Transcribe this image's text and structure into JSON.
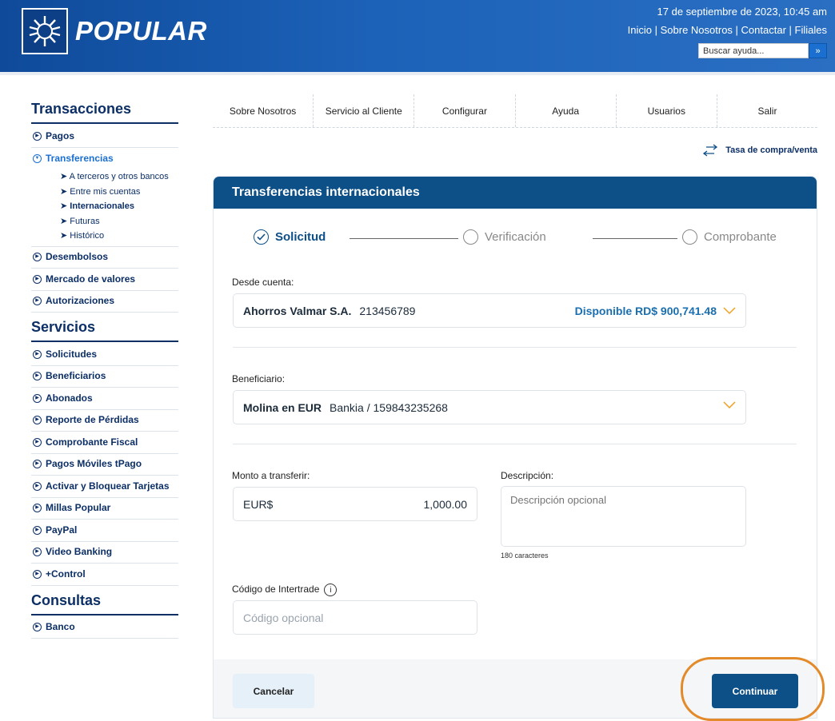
{
  "header": {
    "brand": "POPULAR",
    "datetime": "17 de septiembre de 2023, 10:45 am",
    "links": [
      "Inicio",
      "Sobre Nosotros",
      "Contactar",
      "Filiales"
    ],
    "separator": " | ",
    "search_placeholder": "Buscar ayuda...",
    "search_button": "»"
  },
  "sidebar": {
    "transacciones": {
      "heading": "Transacciones",
      "items": {
        "pagos": "Pagos",
        "transferencias": "Transferencias",
        "sub": [
          "A terceros y otros bancos",
          "Entre mis cuentas",
          "Internacionales",
          "Futuras",
          "Histórico"
        ],
        "desembolsos": "Desembolsos",
        "mercado": "Mercado de valores",
        "autorizaciones": "Autorizaciones"
      }
    },
    "servicios": {
      "heading": "Servicios",
      "items": [
        "Solicitudes",
        "Beneficiarios",
        "Abonados",
        "Reporte de Pérdidas",
        "Comprobante Fiscal",
        "Pagos Móviles tPago",
        "Activar y Bloquear Tarjetas",
        "Millas Popular",
        "PayPal",
        "Video Banking",
        "+Control"
      ]
    },
    "consultas": {
      "heading": "Consultas",
      "items": [
        "Banco"
      ]
    }
  },
  "topnav": [
    "Sobre Nosotros",
    "Servicio al Cliente",
    "Configurar",
    "Ayuda",
    "Usuarios",
    "Salir"
  ],
  "rate_link": "Tasa de compra/venta",
  "card": {
    "title": "Transferencias internacionales",
    "steps": [
      "Solicitud",
      "Verificación",
      "Comprobante"
    ],
    "from": {
      "label": "Desde cuenta:",
      "account_name": "Ahorros Valmar S.A.",
      "account_number": "213456789",
      "available": "Disponible RD$ 900,741.48"
    },
    "beneficiary": {
      "label": "Beneficiario:",
      "name": "Molina en EUR",
      "detail": "Bankia / 159843235268"
    },
    "amount": {
      "label": "Monto a transferir:",
      "currency": "EUR$",
      "value": "1,000.00"
    },
    "description": {
      "label": "Descripción:",
      "placeholder": "Descripción opcional",
      "note": "180 caracteres"
    },
    "intertrade": {
      "label": "Código de Intertrade",
      "placeholder": "Código opcional"
    },
    "buttons": {
      "cancel": "Cancelar",
      "continue": "Continuar"
    }
  },
  "colors": {
    "brand_blue": "#0d4f87",
    "accent_blue": "#1a6fb0",
    "highlight": "#e38a2a",
    "chevron": "#f0a020"
  }
}
